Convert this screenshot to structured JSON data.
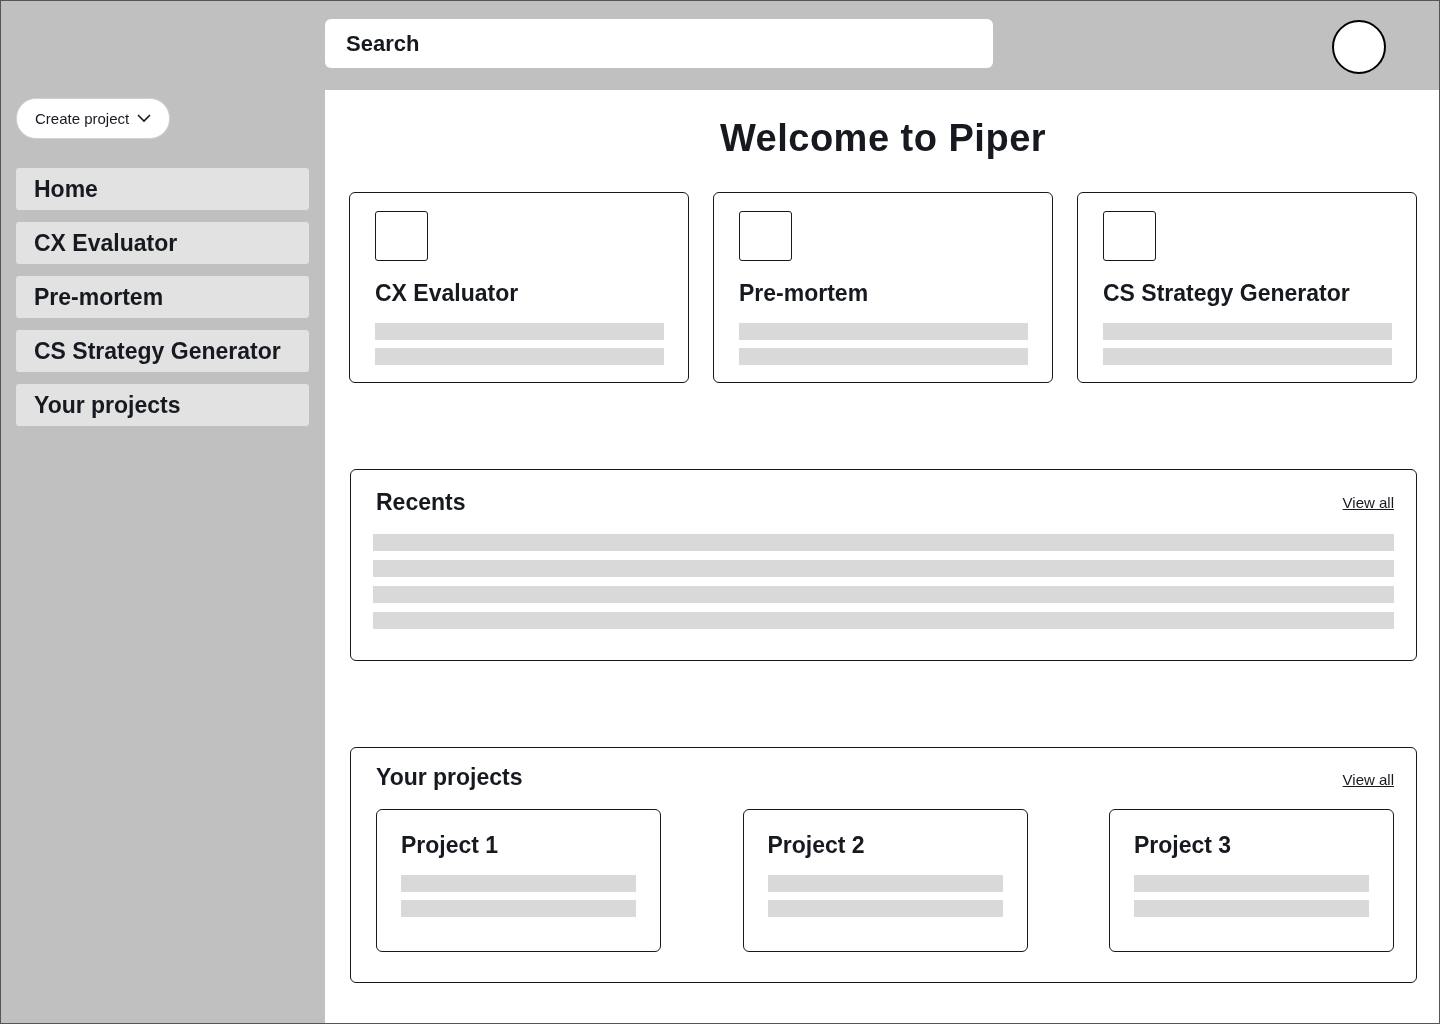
{
  "search": {
    "placeholder": "Search"
  },
  "create_button": "Create project",
  "nav": [
    {
      "label": "Home"
    },
    {
      "label": "CX Evaluator"
    },
    {
      "label": "Pre-mortem"
    },
    {
      "label": "CS Strategy Generator"
    },
    {
      "label": "Your projects"
    }
  ],
  "title": "Welcome to Piper",
  "tools": [
    {
      "title": "CX Evaluator"
    },
    {
      "title": "Pre-mortem"
    },
    {
      "title": "CS Strategy Generator"
    }
  ],
  "recents": {
    "title": "Recents",
    "link": "View all"
  },
  "projects": {
    "title": "Your projects",
    "link": "View all",
    "items": [
      {
        "title": "Project 1"
      },
      {
        "title": "Project 2"
      },
      {
        "title": "Project 3"
      }
    ]
  }
}
